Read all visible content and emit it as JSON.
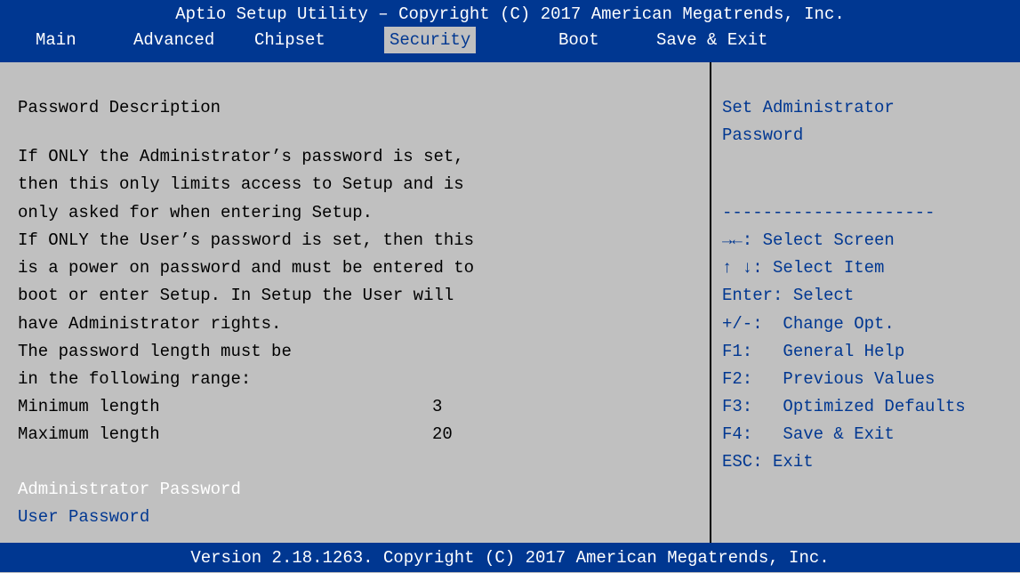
{
  "header": {
    "title": "Aptio Setup Utility – Copyright (C) 2017 American Megatrends, Inc."
  },
  "menu": {
    "tabs": [
      {
        "label": "Main"
      },
      {
        "label": "Advanced"
      },
      {
        "label": "Chipset"
      },
      {
        "label": "Security"
      },
      {
        "label": "Boot"
      },
      {
        "label": "Save & Exit"
      }
    ],
    "active": "Security"
  },
  "main": {
    "heading": "Password Description",
    "description": [
      "If ONLY the Administrator’s password is set,",
      "then this only limits access to Setup and is",
      "only asked for when entering Setup.",
      "If ONLY the User’s password is set, then this",
      "is a power on password and must be entered to",
      "boot or enter Setup. In Setup the User will",
      "have Administrator rights.",
      "The password length must be",
      "in the following range:"
    ],
    "min_label": "Minimum length",
    "min_value": "3",
    "max_label": "Maximum length",
    "max_value": "20",
    "items": [
      {
        "label": "Administrator Password",
        "selected": true
      },
      {
        "label": "User Password",
        "selected": false
      }
    ]
  },
  "help": {
    "description": [
      "Set Administrator",
      "Password"
    ],
    "divider": "---------------------",
    "keys": [
      "→←: Select Screen",
      "↑ ↓: Select Item",
      "Enter: Select",
      "+/-:  Change Opt.",
      "F1:   General Help",
      "F2:   Previous Values",
      "F3:   Optimized Defaults",
      "F4:   Save & Exit",
      "ESC: Exit"
    ]
  },
  "footer": {
    "version": "Version 2.18.1263. Copyright (C) 2017 American Megatrends, Inc."
  },
  "colors": {
    "bar_background": "#003791",
    "panel_background": "#c0c0c0",
    "highlight_text": "#ffffff",
    "link_text": "#003791"
  }
}
